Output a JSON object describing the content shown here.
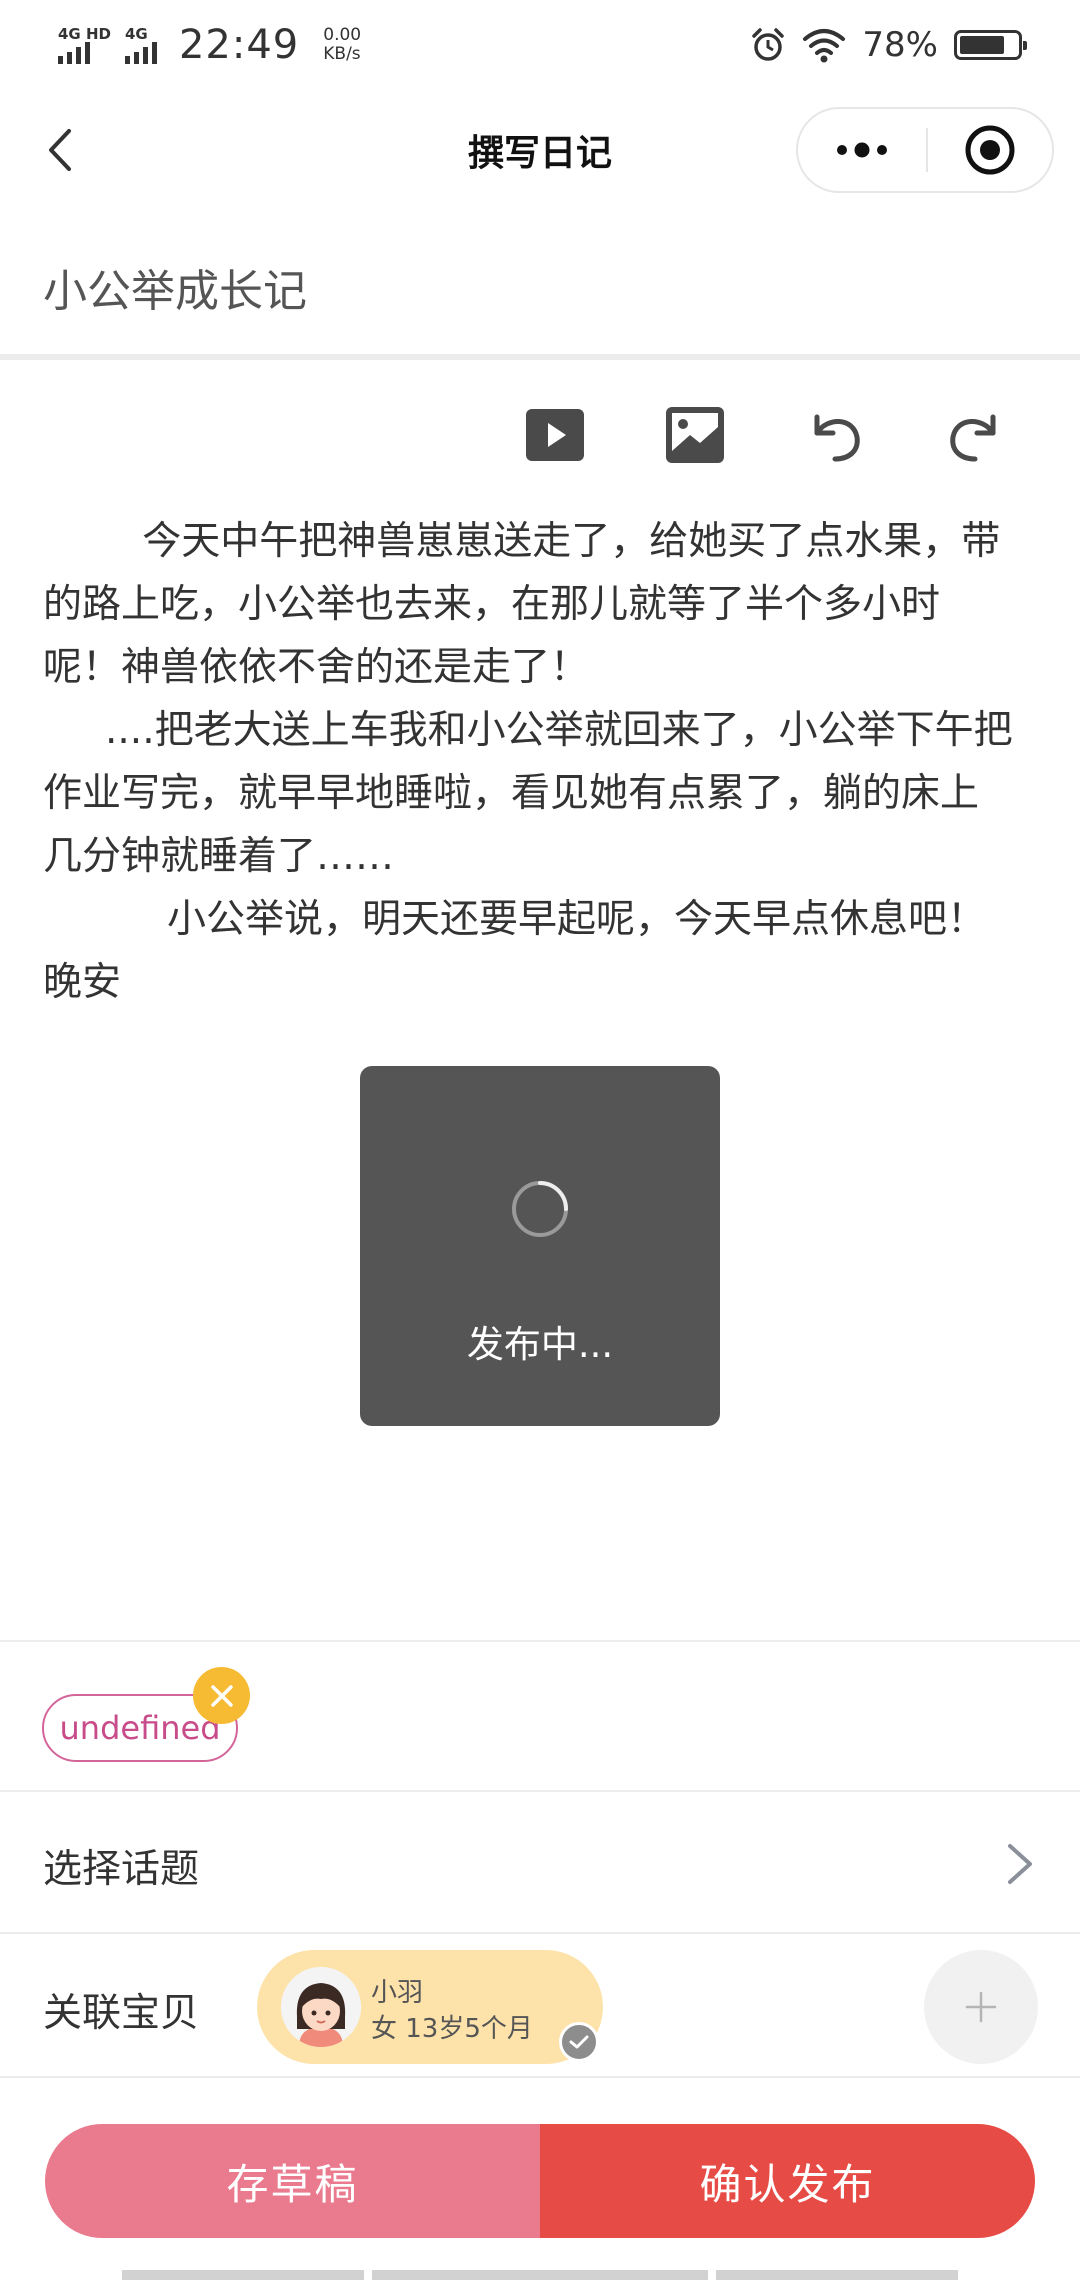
{
  "status_bar": {
    "net1": "4G HD",
    "net2": "4G",
    "time": "22:49",
    "speed_value": "0.00",
    "speed_unit": "KB/s",
    "battery_pct": "78%",
    "battery_level": 0.78
  },
  "nav": {
    "title": "撰写日记"
  },
  "diary": {
    "title": "小公举成长记",
    "body": "        今天中午把神兽崽崽送走了，给她买了点水果，带的路上吃，小公举也去来，在那儿就等了半个多小时呢！神兽依依不舍的还是走了！\n     ....把老大送上车我和小公举就回来了，小公举下午把作业写完，就早早地睡啦，看见她有点累了，躺的床上几分钟就睡着了……\n          小公举说，明天还要早起呢，今天早点休息吧！晚安"
  },
  "toolbar": {
    "icons": [
      "video-icon",
      "image-icon",
      "undo-icon",
      "redo-icon"
    ]
  },
  "toast": {
    "text": "发布中..."
  },
  "tags": {
    "items": [
      "undefined"
    ]
  },
  "topic": {
    "label": "选择话题"
  },
  "baby": {
    "label": "关联宝贝",
    "name": "小羽",
    "info": "女  13岁5个月"
  },
  "buttons": {
    "draft": "存草稿",
    "publish": "确认发布"
  },
  "colors": {
    "tag_border": "#d4659a",
    "tag_remove": "#f6bb33",
    "baby_chip": "#fde3aa",
    "draft_button": "#ea7a8e",
    "publish_button": "#e74b46",
    "toast_bg": "#555555"
  }
}
